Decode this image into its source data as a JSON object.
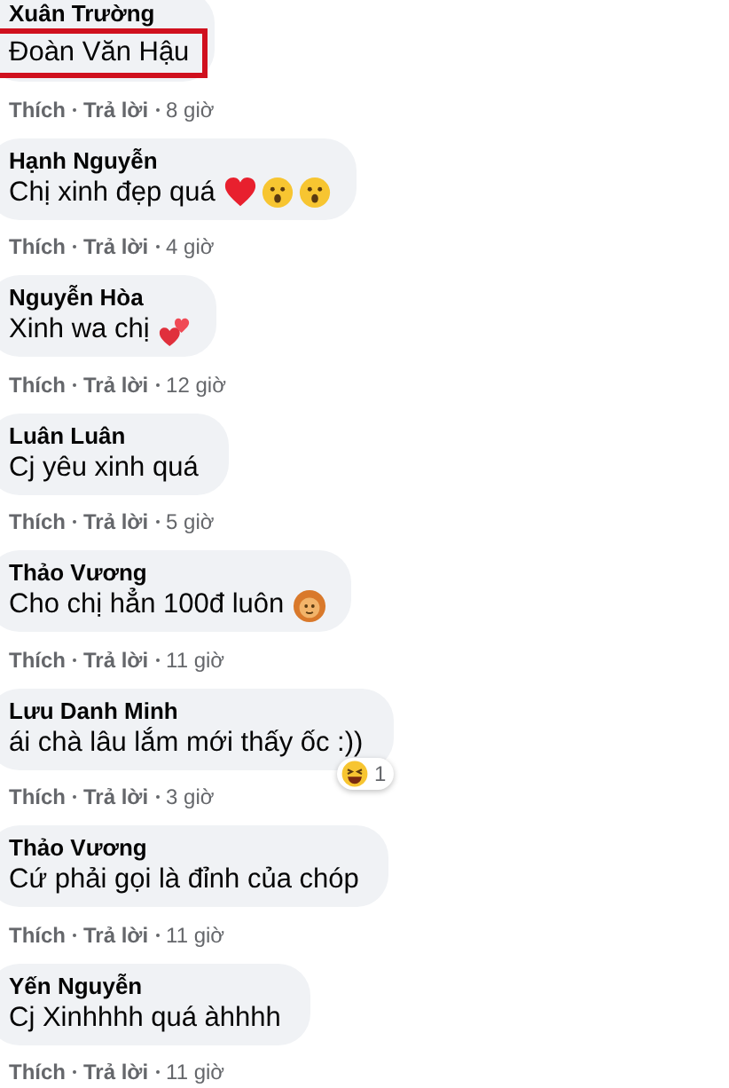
{
  "comments": [
    {
      "name": "Xuân Trường",
      "text": "Đoàn Văn Hậu",
      "highlighted": true,
      "like": "Thích",
      "reply": "Trả lời",
      "time": "8 giờ"
    },
    {
      "name": "Hạnh Nguyễn",
      "text": "Chị xinh đẹp quá",
      "emojis": [
        {
          "kind": "heart"
        },
        {
          "kind": "wow"
        },
        {
          "kind": "wow"
        }
      ],
      "highlighted": false,
      "like": "Thích",
      "reply": "Trả lời",
      "time": "4 giờ"
    },
    {
      "name": "Nguyễn Hòa",
      "text": "Xinh wa chị",
      "emojis": [
        {
          "kind": "hearts"
        }
      ],
      "highlighted": false,
      "like": "Thích",
      "reply": "Trả lời",
      "time": "12 giờ"
    },
    {
      "name": "Luân Luân",
      "text": "Cj yêu xinh quá",
      "highlighted": false,
      "like": "Thích",
      "reply": "Trả lời",
      "time": "5 giờ"
    },
    {
      "name": "Thảo Vương",
      "text": "Cho chị hẳn 100đ luôn",
      "emojis": [
        {
          "kind": "face"
        }
      ],
      "highlighted": false,
      "like": "Thích",
      "reply": "Trả lời",
      "time": "11 giờ"
    },
    {
      "name": "Lưu Danh Minh",
      "text": "ái chà lâu lắm mới thấy ốc :))",
      "highlighted": false,
      "reaction": {
        "count": "1"
      },
      "like": "Thích",
      "reply": "Trả lời",
      "time": "3 giờ"
    },
    {
      "name": "Thảo Vương",
      "text": "Cứ phải gọi là đỉnh của chóp",
      "highlighted": false,
      "like": "Thích",
      "reply": "Trả lời",
      "time": "11 giờ"
    },
    {
      "name": "Yến Nguyễn",
      "text": "Cj Xinhhhh quá àhhhh",
      "highlighted": false,
      "like": "Thích",
      "reply": "Trả lời",
      "time": "11 giờ"
    }
  ]
}
